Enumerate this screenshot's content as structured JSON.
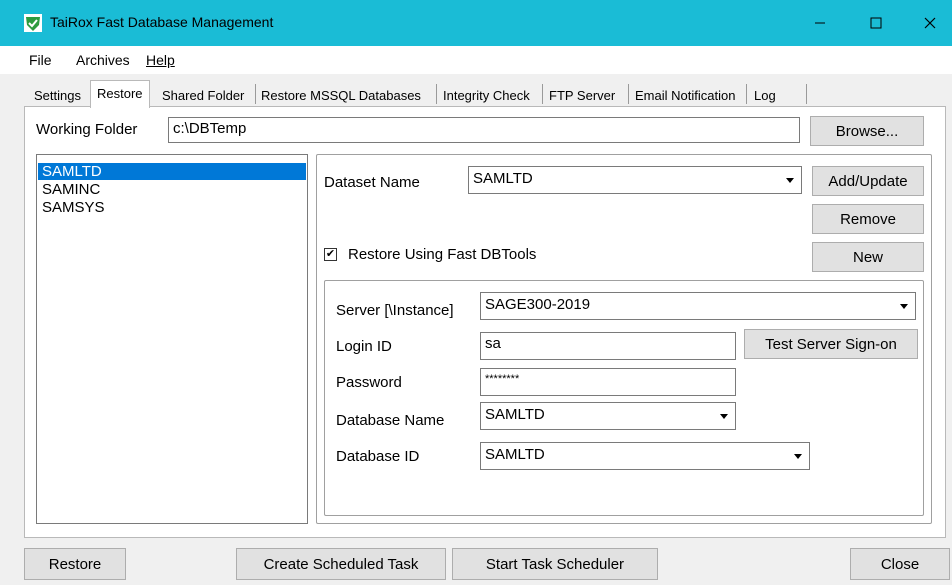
{
  "window": {
    "title": "TaiRox Fast Database Management",
    "icon": "shield-check-icon",
    "accent_color": "#1abcd6"
  },
  "menu": {
    "file": "File",
    "archives": "Archives",
    "help": "Help"
  },
  "tabs": [
    {
      "label": "Settings"
    },
    {
      "label": "Restore"
    },
    {
      "label": "Shared Folder"
    },
    {
      "label": "Restore MSSQL Databases"
    },
    {
      "label": "Integrity Check"
    },
    {
      "label": "FTP Server"
    },
    {
      "label": "Email Notification"
    },
    {
      "label": "Log"
    }
  ],
  "active_tab": "Restore",
  "working_folder": {
    "label": "Working Folder",
    "value": "c:\\DBTemp",
    "browse_label": "Browse..."
  },
  "datasets": {
    "items": [
      "SAMLTD",
      "SAMINC",
      "SAMSYS"
    ],
    "selected": "SAMLTD"
  },
  "dataset_form": {
    "dataset_label": "Dataset Name",
    "dataset_value": "SAMLTD",
    "add_update_label": "Add/Update",
    "remove_label": "Remove",
    "new_label": "New",
    "fast_dbtools_label": "Restore Using Fast DBTools",
    "fast_dbtools_checked": "✔",
    "server_label": "Server [\\Instance]",
    "server_value": "SAGE300-2019",
    "login_label": "Login ID",
    "login_value": "sa",
    "test_signon_label": "Test Server Sign-on",
    "password_label": "Password",
    "password_value": "********",
    "dbname_label": "Database Name",
    "dbname_value": "SAMLTD",
    "dbid_label": "Database ID",
    "dbid_value": "SAMLTD"
  },
  "footer": {
    "restore_label": "Restore",
    "create_task_label": "Create Scheduled Task",
    "start_scheduler_label": "Start Task Scheduler",
    "close_label": "Close"
  }
}
